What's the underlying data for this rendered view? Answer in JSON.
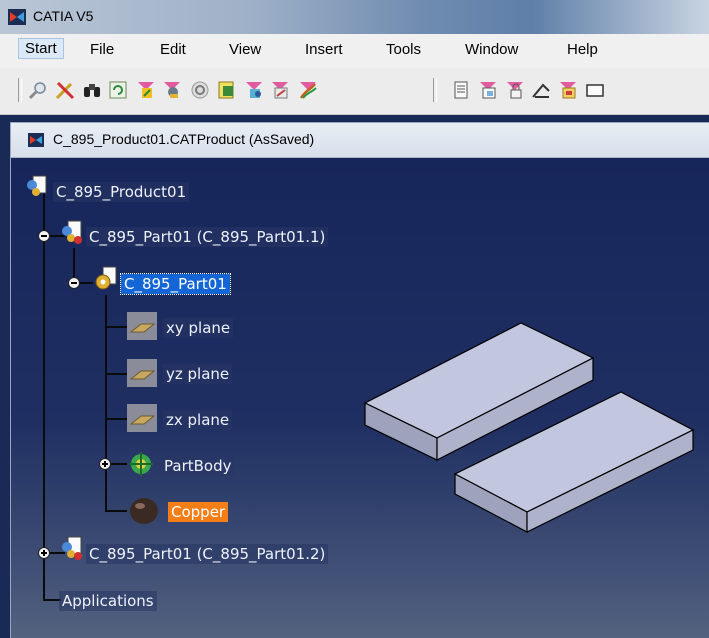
{
  "app": {
    "title": "CATIA V5"
  },
  "menu": {
    "items": [
      {
        "id": "start",
        "label": "Start"
      },
      {
        "id": "file",
        "label": "File"
      },
      {
        "id": "edit",
        "label": "Edit"
      },
      {
        "id": "view",
        "label": "View"
      },
      {
        "id": "insert",
        "label": "Insert"
      },
      {
        "id": "tools",
        "label": "Tools"
      },
      {
        "id": "window",
        "label": "Window"
      },
      {
        "id": "help",
        "label": "Help"
      }
    ]
  },
  "toolbar": {
    "left_icons": [
      "magnifier-icon",
      "tools-icon",
      "binoculars-icon",
      "refresh-icon",
      "measure-icon",
      "user-icon",
      "capture-icon",
      "catalog-icon",
      "publication-icon",
      "knowledge-icon",
      "sketch-icon"
    ],
    "right_icons": [
      "document-icon",
      "window-icon",
      "lock-icon",
      "constraint-icon",
      "analysis-icon",
      "frame-icon"
    ]
  },
  "document": {
    "window_title": "C_895_Product01.CATProduct (AsSaved)"
  },
  "tree": {
    "root": "C_895_Product01",
    "part_instance_1": "C_895_Part01 (C_895_Part01.1)",
    "part": "C_895_Part01",
    "xy_plane": "xy plane",
    "yz_plane": "yz plane",
    "zx_plane": "zx plane",
    "part_body": "PartBody",
    "material": "Copper",
    "part_instance_2": "C_895_Part01 (C_895_Part01.2)",
    "applications": "Applications"
  },
  "colors": {
    "viewport_background": "#1f2f62",
    "selection": "#1466d6",
    "material_highlight": "#f57e16",
    "part_face": "#c3c6df"
  }
}
